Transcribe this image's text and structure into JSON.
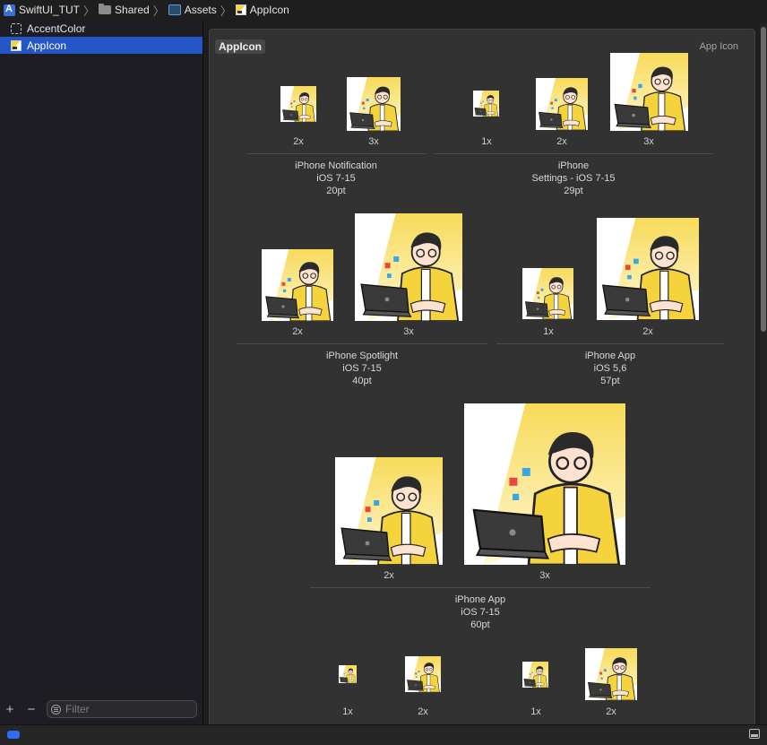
{
  "breadcrumb": [
    "SwiftUI_TUT",
    "Shared",
    "Assets",
    "AppIcon"
  ],
  "sidebar": {
    "items": [
      {
        "label": "AccentColor",
        "selected": false
      },
      {
        "label": "AppIcon",
        "selected": true
      }
    ],
    "add_symbol": "+",
    "remove_symbol": "−",
    "filter_placeholder": "Filter"
  },
  "editor": {
    "title": "AppIcon",
    "type_label": "App Icon",
    "groups": {
      "notification": {
        "name": "iPhone Notification",
        "os": "iOS 7-15",
        "size": "20pt",
        "scales": [
          "2x",
          "3x"
        ]
      },
      "settings": {
        "name": "iPhone",
        "os": "Settings - iOS 7-15",
        "size": "29pt",
        "scales": [
          "1x",
          "2x",
          "3x"
        ]
      },
      "spotlight": {
        "name": "iPhone Spotlight",
        "os": "iOS 7-15",
        "size": "40pt",
        "scales": [
          "2x",
          "3x"
        ]
      },
      "app_57": {
        "name": "iPhone App",
        "os": "iOS 5,6",
        "size": "57pt",
        "scales": [
          "1x",
          "2x"
        ]
      },
      "app_60": {
        "name": "iPhone App",
        "os": "iOS 7-15",
        "size": "60pt",
        "scales": [
          "2x",
          "3x"
        ]
      },
      "row4_left": {
        "scales": [
          "1x",
          "2x"
        ]
      },
      "row4_right": {
        "scales": [
          "1x",
          "2x"
        ]
      }
    }
  },
  "colors": {
    "accent": "#2456c7",
    "icon_yellow": "#f5d43c"
  }
}
